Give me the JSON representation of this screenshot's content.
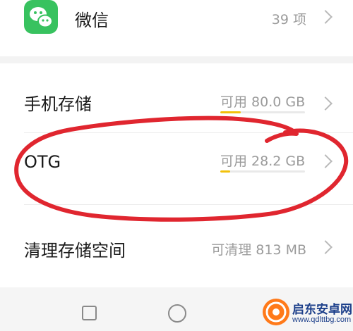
{
  "storage_list": {
    "wechat": {
      "label": "微信",
      "value": "39 项"
    },
    "phone_storage": {
      "label": "手机存储",
      "value": "可用 80.0 GB",
      "used_fraction": 0.11
    },
    "otg": {
      "label": "OTG",
      "value": "可用 28.2 GB",
      "used_fraction": 0.06
    },
    "cleanup": {
      "label": "清理存储空间",
      "value": "可清理 813 MB"
    }
  },
  "annotation": {
    "color": "#e0262f"
  },
  "watermark": {
    "title": "启东安卓网",
    "url": "www.qdlttbg.com"
  },
  "colors": {
    "bar_fill": "#f2c10c",
    "wechat_green": "#38c25f"
  }
}
